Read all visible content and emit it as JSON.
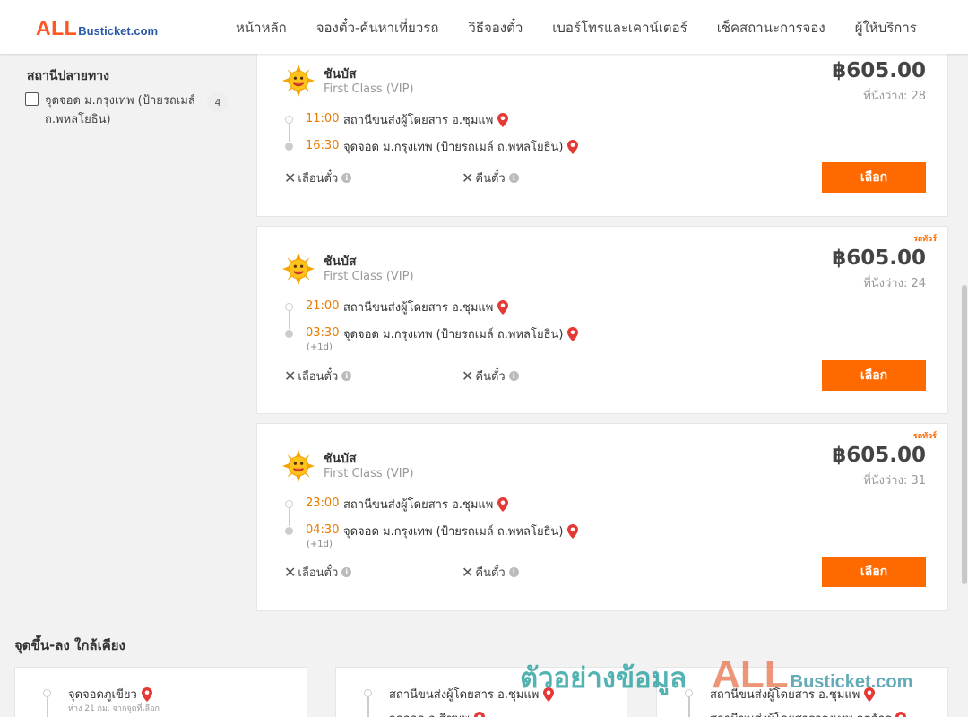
{
  "header": {
    "logo_all": "ALL",
    "logo_rest": "Busticket.com",
    "nav": [
      "หน้าหลัก",
      "จองตั๋ว-ค้นหาเที่ยวรถ",
      "วิธีจองตั๋ว",
      "เบอร์โทรและเคาน์เตอร์",
      "เช็คสถานะการจอง",
      "ผู้ให้บริการ"
    ]
  },
  "filter": {
    "title": "สถานีปลายทาง",
    "option_label": "จุดจอด ม.กรุงเทพ (ป้ายรถเมล์ ถ.พหลโยธิน)",
    "option_count": "4"
  },
  "trips": [
    {
      "operator": "ชันบัส",
      "bus_class": "First Class (VIP)",
      "price": "฿605.00",
      "seats": "ที่นั่งว่าง: 28",
      "tag": "",
      "depart_time": "11:00",
      "depart_station": "สถานีขนส่งผู้โดยสาร อ.ชุมแพ",
      "arrive_time": "16:30",
      "arrive_station": "จุดจอด ม.กรุงเทพ (ป้ายรถเมล์ ถ.พหลโยธิน)",
      "plus_day": "",
      "policy_change": "เลื่อนตั๋ว",
      "policy_refund": "คืนตั๋ว",
      "select_label": "เลือก"
    },
    {
      "operator": "ชันบัส",
      "bus_class": "First Class (VIP)",
      "price": "฿605.00",
      "seats": "ที่นั่งว่าง: 24",
      "tag": "รถทัวร์",
      "depart_time": "21:00",
      "depart_station": "สถานีขนส่งผู้โดยสาร อ.ชุมแพ",
      "arrive_time": "03:30",
      "arrive_station": "จุดจอด ม.กรุงเทพ (ป้ายรถเมล์ ถ.พหลโยธิน)",
      "plus_day": "(+1d)",
      "policy_change": "เลื่อนตั๋ว",
      "policy_refund": "คืนตั๋ว",
      "select_label": "เลือก"
    },
    {
      "operator": "ชันบัส",
      "bus_class": "First Class (VIP)",
      "price": "฿605.00",
      "seats": "ที่นั่งว่าง: 31",
      "tag": "รถทัวร์",
      "depart_time": "23:00",
      "depart_station": "สถานีขนส่งผู้โดยสาร อ.ชุมแพ",
      "arrive_time": "04:30",
      "arrive_station": "จุดจอด ม.กรุงเทพ (ป้ายรถเมล์ ถ.พหลโยธิน)",
      "plus_day": "(+1d)",
      "policy_change": "เลื่อนตั๋ว",
      "policy_refund": "คืนตั๋ว",
      "select_label": "เลือก"
    }
  ],
  "nearby": {
    "title": "จุดขึ้น-ลง ใกล้เคียง",
    "cards": [
      {
        "name": "จุดจอดภูเขียว",
        "sub": "ห่าง 21 กม. จากจุดที่เลือก",
        "name2": ""
      },
      {
        "name": "สถานีขนส่งผู้โดยสาร อ.ชุมแพ",
        "sub": "",
        "name2": "จุดจอด อ.สีชมพู"
      },
      {
        "name": "สถานีขนส่งผู้โดยสาร อ.ชุมแพ",
        "sub": "",
        "name2": "สถานีขนส่งผู้โดยสารกรุงเทพ จตุจักร"
      }
    ]
  },
  "watermark": {
    "thai": "ตัวอย่างข้อมูล",
    "all": "ALL",
    "rest": "Busticket.com"
  },
  "colors": {
    "accent_orange": "#ff6a00",
    "time_orange": "#e87b00",
    "logo_blue": "#2b5aa5",
    "pin_red": "#e53935"
  },
  "icons": [
    "sun-logo-icon",
    "map-pin-icon",
    "x-icon",
    "info-icon",
    "checkbox"
  ]
}
